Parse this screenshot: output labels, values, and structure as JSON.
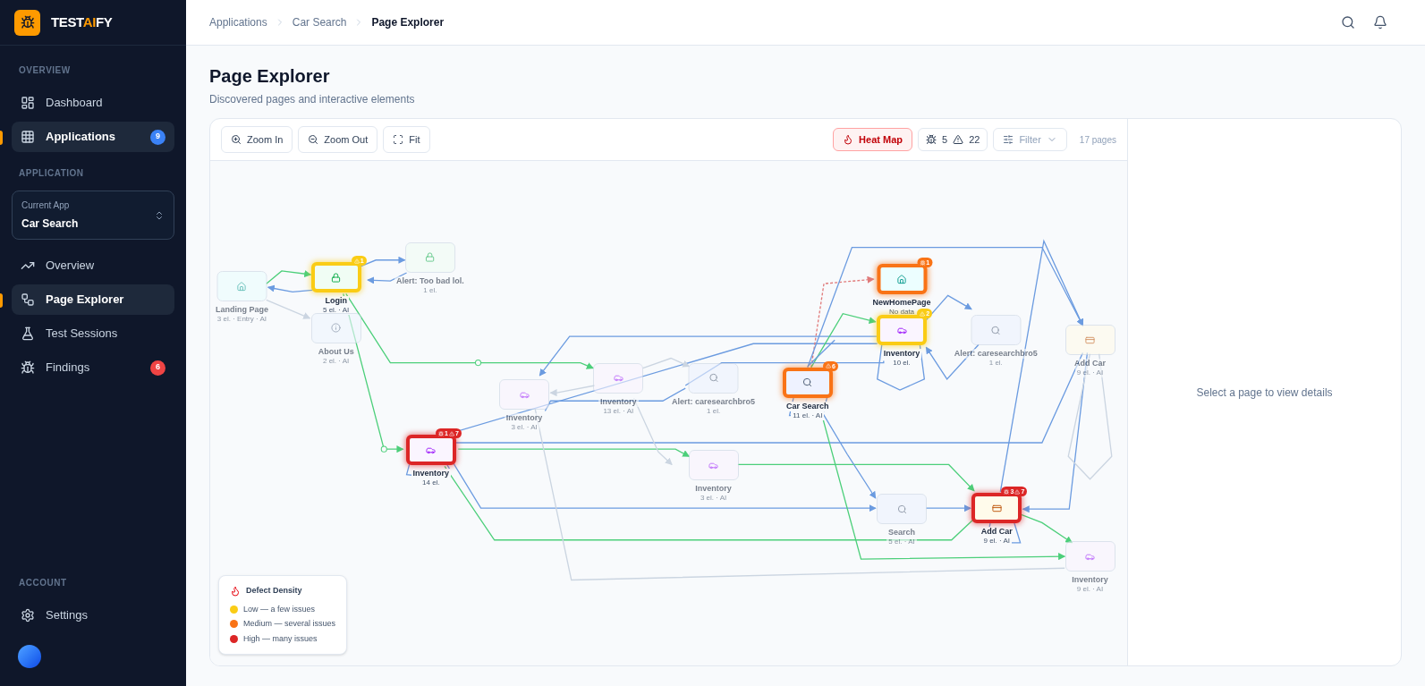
{
  "sidebar": {
    "logo": [
      {
        "text": "TEST",
        "accent": false
      },
      {
        "text": "AI",
        "accent": true
      },
      {
        "text": "FY",
        "accent": false
      }
    ],
    "sections": [
      {
        "title": "OVERVIEW",
        "items": [
          {
            "label": "Dashboard",
            "selected": false
          },
          {
            "label": "Applications",
            "selected": true,
            "badge": {
              "text": "9",
              "color": "#3b82f6"
            }
          }
        ]
      },
      {
        "title": "APPLICATION",
        "app_picker": {
          "label": "Current App",
          "value": "Car Search"
        },
        "items": [
          {
            "label": "Overview",
            "selected": false
          },
          {
            "label": "Page Explorer",
            "selected": true
          },
          {
            "label": "Test Sessions",
            "selected": false
          },
          {
            "label": "Findings",
            "selected": false,
            "badge": {
              "text": "6",
              "color": "#ef4444"
            }
          }
        ]
      },
      {
        "title": "ACCOUNT",
        "items": [
          {
            "label": "Settings",
            "selected": false
          }
        ]
      }
    ]
  },
  "breadcrumbs": [
    {
      "label": "Applications",
      "current": false
    },
    {
      "label": "Car Search",
      "current": false
    },
    {
      "label": "Page Explorer",
      "current": true
    }
  ],
  "page": {
    "title": "Page Explorer",
    "subtitle": "Discovered pages and interactive elements"
  },
  "toolbar": {
    "zoom_buttons": [
      "Zoom In",
      "Zoom Out",
      "Fit"
    ],
    "heat_map": {
      "label": "Heat Map",
      "on": true
    },
    "stats": [
      {
        "kind": "bug",
        "count": "5"
      },
      {
        "kind": "warning",
        "count": "22"
      }
    ],
    "filter": {
      "label": "Filter"
    },
    "page_count": "17 pages"
  },
  "nodes": [
    {
      "title": "Landing Page",
      "meta": "3 el. · Entry · AI",
      "kind": "home",
      "dimmed": true
    },
    {
      "title": "Login",
      "meta": "5 el. · AI",
      "kind": "lock",
      "color": "#facc15",
      "dimmed": false,
      "badges": [
        {
          "kind": "warning",
          "count": "1"
        }
      ]
    },
    {
      "title": "Alert: Too bad lol.",
      "meta": "1 el.",
      "kind": "lock",
      "dimmed": true
    },
    {
      "title": "About Us",
      "meta": "2 el. · AI",
      "kind": "info",
      "dimmed": true
    },
    {
      "title": "Inventory",
      "meta": "14 el.",
      "kind": "car",
      "color": "#dc2626",
      "dimmed": false,
      "badges": [
        {
          "kind": "bug",
          "count": "1"
        },
        {
          "kind": "warning",
          "count": "7"
        }
      ]
    },
    {
      "title": "Inventory",
      "meta": "3 el. · AI",
      "kind": "car",
      "dimmed": true
    },
    {
      "title": "Inventory",
      "meta": "13 el. · AI",
      "kind": "car",
      "dimmed": true
    },
    {
      "title": "Alert: caresearchbro5",
      "meta": "1 el.",
      "kind": "search",
      "dimmed": true
    },
    {
      "title": "Inventory",
      "meta": "3 el. · AI",
      "kind": "car",
      "dimmed": true
    },
    {
      "title": "Car Search",
      "meta": "11 el. · AI",
      "kind": "search",
      "color": "#f97316",
      "dimmed": false,
      "badges": [
        {
          "kind": "warning",
          "count": "6"
        }
      ]
    },
    {
      "title": "NewHomePage",
      "meta": "No data",
      "kind": "home",
      "color": "#f97316",
      "dimmed": false,
      "badges": [
        {
          "kind": "bug",
          "count": "1"
        }
      ]
    },
    {
      "title": "Inventory",
      "meta": "10 el.",
      "kind": "car",
      "color": "#facc15",
      "dimmed": false,
      "badges": [
        {
          "kind": "warning",
          "count": "2"
        }
      ]
    },
    {
      "title": "Alert: caresearchbro5",
      "meta": "1 el.",
      "kind": "search",
      "dimmed": true
    },
    {
      "title": "Add Car",
      "meta": "9 el. · AI",
      "kind": "card",
      "dimmed": true
    },
    {
      "title": "Search",
      "meta": "5 el. · AI",
      "kind": "search",
      "dimmed": true
    },
    {
      "title": "Add Car",
      "meta": "9 el. · AI",
      "kind": "card",
      "color": "#dc2626",
      "dimmed": false,
      "badges": [
        {
          "kind": "bug",
          "count": "3"
        },
        {
          "kind": "warning",
          "count": "7"
        }
      ]
    },
    {
      "title": "Inventory",
      "meta": "9 el. · AI",
      "kind": "car",
      "dimmed": true
    }
  ],
  "legend": {
    "title": "Defect Density",
    "items": [
      {
        "label": "Low — a few issues",
        "color": "#facc15"
      },
      {
        "label": "Medium — several issues",
        "color": "#f97316"
      },
      {
        "label": "High — many issues",
        "color": "#dc2626"
      }
    ]
  },
  "details": {
    "empty_text": "Select a page to view details"
  }
}
